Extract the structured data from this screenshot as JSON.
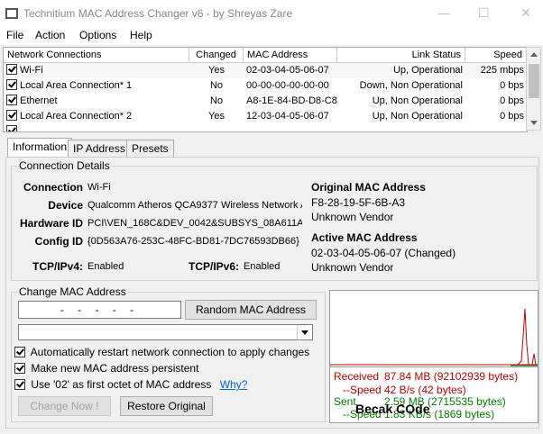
{
  "window": {
    "title": "Technitium MAC Address Changer v6 - by Shreyas Zare"
  },
  "menu": [
    "File",
    "Action",
    "Options",
    "Help"
  ],
  "grid": {
    "columns": [
      "Network Connections",
      "Changed",
      "MAC Address",
      "Link Status",
      "Speed"
    ],
    "rows": [
      {
        "name": "Wi-Fi",
        "changed": "Yes",
        "mac": "02-03-04-05-06-07",
        "status": "Up, Operational",
        "speed": "225 mbps",
        "checked": true
      },
      {
        "name": "Local Area Connection* 1",
        "changed": "No",
        "mac": "00-00-00-00-00-00",
        "status": "Down, Non Operational",
        "speed": "0 bps",
        "checked": true
      },
      {
        "name": "Ethernet",
        "changed": "No",
        "mac": "A8-1E-84-BD-D8-C8",
        "status": "Up, Non Operational",
        "speed": "0 bps",
        "checked": true
      },
      {
        "name": "Local Area Connection* 2",
        "changed": "Yes",
        "mac": "12-03-04-05-06-07",
        "status": "Up, Non Operational",
        "speed": "0 bps",
        "checked": true
      }
    ]
  },
  "tabs": [
    "Information",
    "IP Address",
    "Presets"
  ],
  "details": {
    "legend": "Connection Details",
    "connection_label": "Connection",
    "connection_value": "Wi-Fi",
    "device_label": "Device",
    "device_value": "Qualcomm Atheros QCA9377 Wireless Network A",
    "hwid_label": "Hardware ID",
    "hwid_value": "PCI\\VEN_168C&DEV_0042&SUBSYS_08A611A",
    "config_label": "Config ID",
    "config_value": "{0D563A76-253C-48FC-BD81-7DC76593DB66}",
    "tcp4_label": "TCP/IPv4:",
    "tcp4_value": "Enabled",
    "tcp6_label": "TCP/IPv6:",
    "tcp6_value": "Enabled",
    "orig_mac_label": "Original MAC Address",
    "orig_mac_value": "F8-28-19-5F-6B-A3",
    "orig_vendor": "Unknown Vendor",
    "active_mac_label": "Active MAC Address",
    "active_mac_value": "02-03-04-05-06-07 (Changed)",
    "active_vendor": "Unknown Vendor"
  },
  "change": {
    "legend": "Change MAC Address",
    "mac_placeholder": "-   -   -   -   -",
    "random_button": "Random MAC Address",
    "opt_restart": "Automatically restart network connection to apply changes",
    "opt_persistent": "Make new MAC address persistent",
    "opt_02": "Use '02' as first octet of MAC address",
    "why_link": "Why?",
    "change_button": "Change Now !",
    "restore_button": "Restore Original"
  },
  "stats": {
    "received_label": "Received",
    "received_value": "87.84 MB (92102939 bytes)",
    "rx_speed_label": "--Speed",
    "rx_speed_value": "42 B/s (42 bytes)",
    "sent_label": "Sent",
    "sent_value": "2.59 MB (2715535 bytes)",
    "tx_speed_label": "--Speed",
    "tx_speed_value": "1.83 KB/s (1869 bytes)",
    "watermark": "Becak COde"
  },
  "colors": {
    "received": "#c00000",
    "sent": "#008000"
  }
}
